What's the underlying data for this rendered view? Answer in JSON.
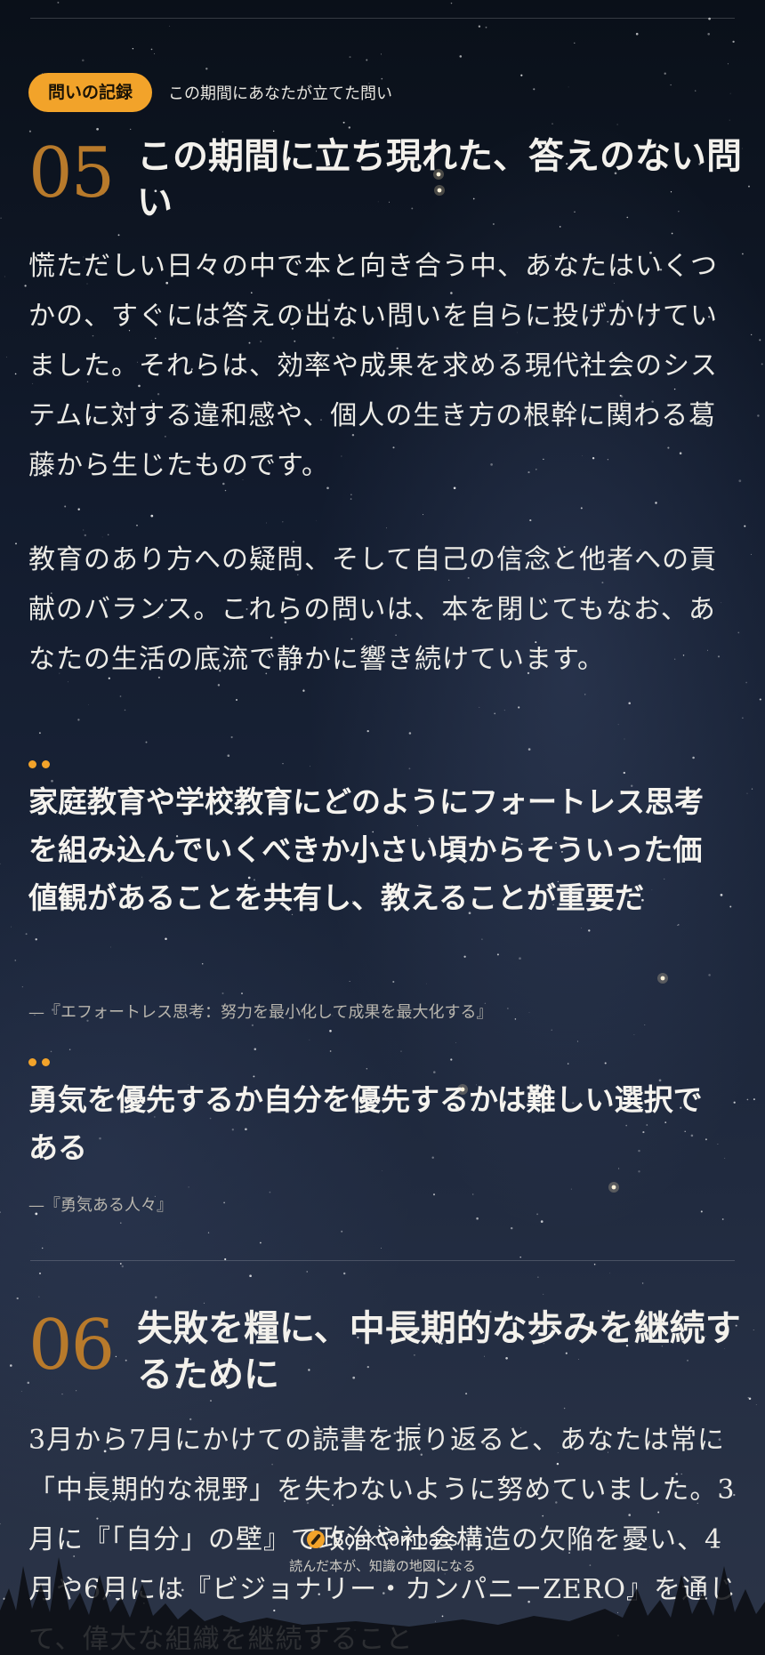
{
  "colors": {
    "accent": "#f2a32a",
    "section_number": "#b87a2b",
    "text": "#ecebe6"
  },
  "tag": {
    "label": "問いの記録",
    "caption": "この期間にあなたが立てた問い"
  },
  "section5": {
    "number": "05",
    "title": "この期間に立ち現れた、答えのない問い",
    "paragraph1": "慌ただしい日々の中で本と向き合う中、あなたはいくつかの、すぐには答えの出ない問いを自らに投げかけていました。それらは、効率や成果を求める現代社会のシステムに対する違和感や、個人の生き方の根幹に関わる葛藤から生じたものです。",
    "paragraph2": "教育のあり方への疑問、そして自己の信念と他者への貢献のバランス。これらの問いは、本を閉じてもなお、あなたの生活の底流で静かに響き続けています。",
    "quotes": [
      {
        "text": "家庭教育や学校教育にどのようにフォートレス思考を組み込んでいくべきか小さい頃からそういった価値観があることを共有し、教えることが重要だ",
        "source": "—『エフォートレス思考：努力を最小化して成果を最大化する』"
      },
      {
        "text": "勇気を優先するか自分を優先するかは難しい選択である",
        "source": "—『勇気ある人々』"
      }
    ]
  },
  "section6": {
    "number": "06",
    "title": "失敗を糧に、中長期的な歩みを継続するために",
    "paragraph1": "3月から7月にかけての読書を振り返ると、あなたは常に「中長期的な視野」を失わないように努めていました。3月に『「自分」の壁』で政治や社会構造の欠陥を憂い、4月や6月には『ビジョナリー・カンパニーZERO』を通じて、偉大な組織を継続すること"
  },
  "footer": {
    "brand": "BookCompass",
    "tagline": "読んだ本が、知識の地図になる"
  }
}
